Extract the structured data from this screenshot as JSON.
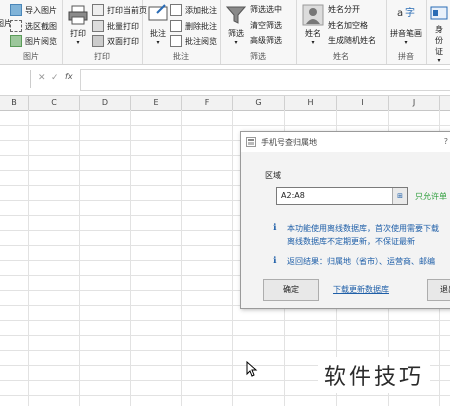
{
  "ribbon": {
    "groups": [
      {
        "label": "图片",
        "items": [
          "导入图片",
          "选区截图",
          "图片阅览"
        ],
        "big": "图片"
      },
      {
        "label": "打印",
        "big": "打印",
        "items": [
          "打印当前页",
          "批量打印",
          "双面打印"
        ]
      },
      {
        "label": "批注",
        "big": "批注",
        "items": [
          "添加批注",
          "删除批注",
          "批注阅览"
        ]
      },
      {
        "label": "筛选",
        "big": "筛选",
        "items": [
          "筛选选中",
          "清空筛选",
          "高级筛选"
        ]
      },
      {
        "label": "姓名",
        "big": "姓名",
        "items": [
          "姓名分开",
          "姓名加空格",
          "生成随机姓名"
        ]
      },
      {
        "label": "拼音",
        "big": "拼音笔画",
        "big_sub": "▾"
      },
      {
        "label": "",
        "big": "身份证",
        "big_sub": "▾"
      }
    ]
  },
  "formula_bar": {
    "fx": "fx"
  },
  "columns": [
    "B",
    "C",
    "D",
    "E",
    "F",
    "G",
    "H",
    "I",
    "J"
  ],
  "dialog": {
    "title": "手机号查归属地",
    "help": "?",
    "section_label": "区域",
    "range_value": "A2:A8",
    "range_hint": "只允许单",
    "info1_line1": "本功能使用离线数据库，首次使用需要下载",
    "info1_line2": "离线数据库不定期更新，不保证最新",
    "info2": "返回结果：归属地（省市）、运营商、邮编",
    "ok_label": "确定",
    "link_label": "下载更新数据库",
    "exit_label": "退出"
  },
  "watermark": "软件技巧",
  "colors": {
    "accent": "#1f5fa8",
    "hint_green": "#2f9e3c"
  }
}
